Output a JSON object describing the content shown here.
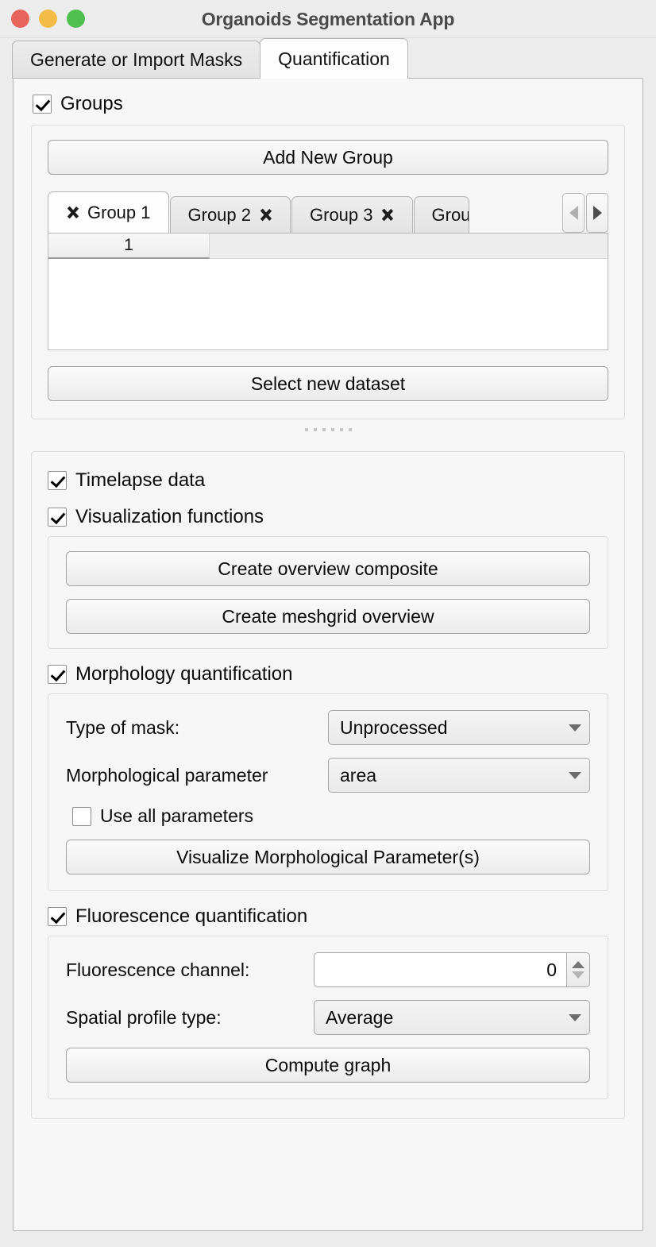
{
  "window": {
    "title": "Organoids Segmentation App",
    "traffic_lights": [
      "close-button",
      "minimize-button",
      "zoom-button"
    ]
  },
  "main_tabs": [
    {
      "label": "Generate or Import Masks",
      "active": false
    },
    {
      "label": "Quantification",
      "active": true
    }
  ],
  "groups_section": {
    "checkbox_label": "Groups",
    "checked": true,
    "add_button": "Add New Group",
    "tabs": [
      {
        "label": "Group 1",
        "active": true,
        "close_side": "left"
      },
      {
        "label": "Group 2",
        "active": false,
        "close_side": "right"
      },
      {
        "label": "Group 3",
        "active": false,
        "close_side": "right"
      },
      {
        "label": "Grou",
        "active": false,
        "close_side": "none",
        "clipped": true
      }
    ],
    "nav_prev_icon": "chevron-left-icon",
    "nav_next_icon": "chevron-right-icon",
    "table": {
      "columns": [
        "1"
      ],
      "rows": []
    },
    "select_dataset_button": "Select new dataset"
  },
  "options_section": {
    "timelapse": {
      "label": "Timelapse data",
      "checked": true
    },
    "visualization": {
      "label": "Visualization functions",
      "checked": true,
      "buttons": [
        "Create overview composite",
        "Create meshgrid overview"
      ]
    },
    "morphology": {
      "label": "Morphology quantification",
      "checked": true,
      "mask_type_label": "Type of mask:",
      "mask_type_value": "Unprocessed",
      "parameter_label": "Morphological parameter",
      "parameter_value": "area",
      "use_all_label": "Use all parameters",
      "use_all_checked": false,
      "visualize_button": "Visualize Morphological Parameter(s)"
    },
    "fluorescence": {
      "label": "Fluorescence quantification",
      "checked": true,
      "channel_label": "Fluorescence channel:",
      "channel_value": "0",
      "profile_label": "Spatial profile type:",
      "profile_value": "Average",
      "compute_button": "Compute graph"
    }
  }
}
